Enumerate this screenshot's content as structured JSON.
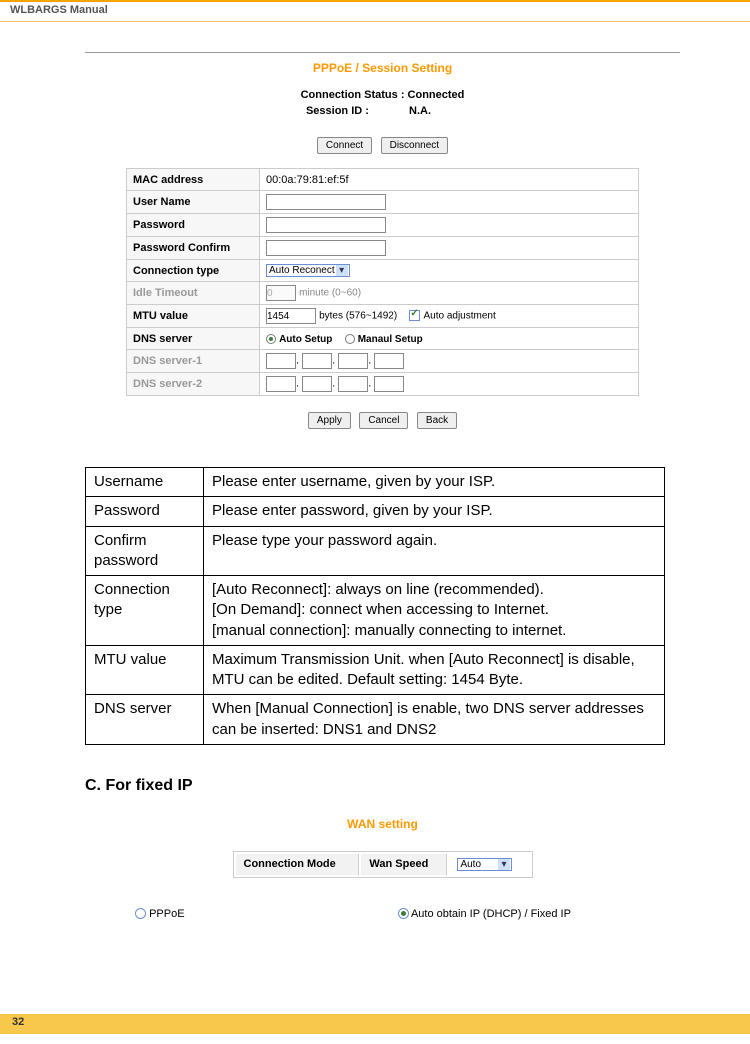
{
  "header": {
    "title": "WLBARGS Manual"
  },
  "pppoe": {
    "section_title": "PPPoE / Session Setting",
    "status_label": "Connection Status :",
    "status_value": "Connected",
    "session_label": "Session ID :",
    "session_value": "N.A.",
    "connect_btn": "Connect",
    "disconnect_btn": "Disconnect",
    "rows": {
      "mac_label": "MAC address",
      "mac_value": "00:0a:79:81:ef:5f",
      "user_label": "User Name",
      "pass_label": "Password",
      "passc_label": "Password Confirm",
      "conntype_label": "Connection type",
      "conntype_value": "Auto Reconect",
      "idle_label": "Idle Timeout",
      "idle_value": "0",
      "idle_unit": "minute (0~60)",
      "mtu_label": "MTU value",
      "mtu_value": "1454",
      "mtu_hint": "bytes (576~1492)",
      "mtu_chk": "Auto adjustment",
      "dns_label": "DNS server",
      "dns_auto": "Auto Setup",
      "dns_manual": "Manaul Setup",
      "dns1_label": "DNS server-1",
      "dns2_label": "DNS server-2"
    },
    "apply": "Apply",
    "cancel": "Cancel",
    "back": "Back"
  },
  "defs": [
    {
      "k": "Username",
      "v": "Please enter username, given by your ISP."
    },
    {
      "k": "Password",
      "v": "Please enter password, given by your ISP."
    },
    {
      "k": "Confirm password",
      "v": "Please type your password again."
    },
    {
      "k": "Connection type",
      "v": "[Auto Reconnect]:  always on line (recommended).\n[On Demand]: connect when accessing to Internet.\n[manual connection]: manually connecting to internet."
    },
    {
      "k": "MTU value",
      "v": "Maximum Transmission Unit. when [Auto Reconnect] is disable, MTU can be edited. Default setting: 1454 Byte."
    },
    {
      "k": "DNS server",
      "v": "When [Manual Connection] is enable, two DNS server addresses can be inserted: DNS1 and DNS2"
    }
  ],
  "subhead": "C. For fixed IP",
  "wan": {
    "title": "WAN setting",
    "mode_label": "Connection Mode",
    "speed_label": "Wan Speed",
    "speed_value": "Auto",
    "opt_pppoe": "PPPoE",
    "opt_dhcp": "Auto obtain IP (DHCP) / Fixed IP"
  },
  "page": "32"
}
